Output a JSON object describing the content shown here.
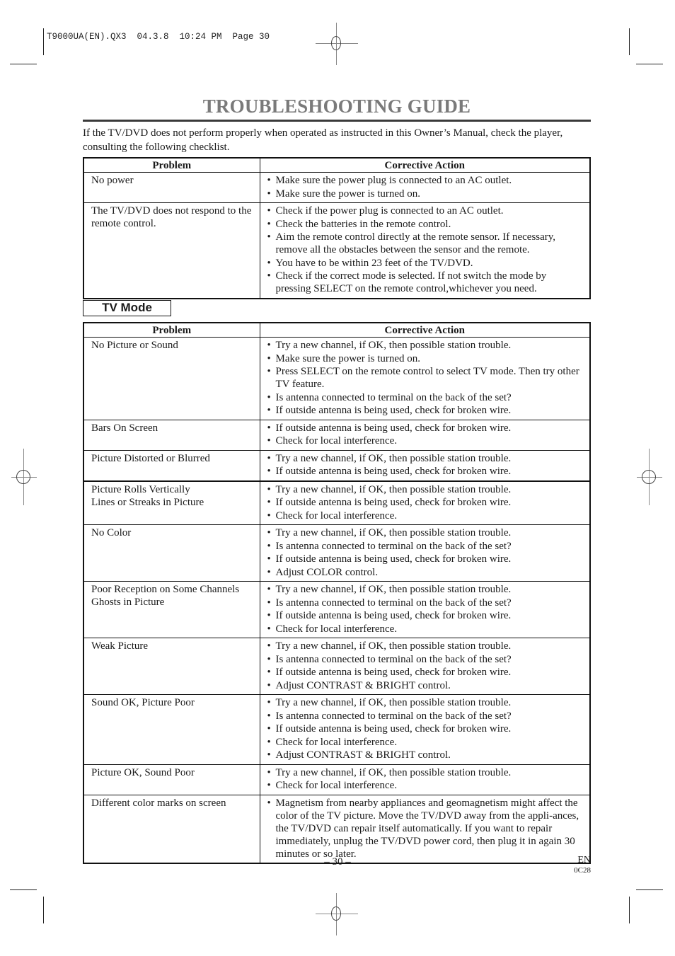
{
  "slug": "T9000UA(EN).QX3  04.3.8  10:24 PM  Page 30",
  "title": "TROUBLESHOOTING GUIDE",
  "intro": "If the TV/DVD does not perform properly when operated as instructed in this Owner’s Manual, check the player, consulting the following checklist.",
  "colors": {
    "title": "#7a7a7a",
    "rule": "#3a3a3a",
    "text": "#1a1a1a"
  },
  "general_table": {
    "headers": {
      "problem": "Problem",
      "action": "Corrective Action"
    },
    "rows": [
      {
        "problem": [
          "No power"
        ],
        "actions": [
          "Make sure the power plug is connected to an AC outlet.",
          "Make sure the power is turned on."
        ]
      },
      {
        "problem": [
          "The TV/DVD does not respond to the remote control."
        ],
        "actions": [
          "Check if the power plug is connected to an AC outlet.",
          "Check the batteries in the remote control.",
          "Aim the remote control directly at the remote sensor. If necessary, remove all the obstacles between the sensor and the remote.",
          "You have to be within 23 feet of the TV/DVD.",
          "Check if the correct mode is selected. If not switch the mode by pressing SELECT on the remote control,whichever you need."
        ]
      }
    ]
  },
  "tv_mode": {
    "label": "TV Mode",
    "headers": {
      "problem": "Problem",
      "action": "Corrective Action"
    },
    "rows": [
      {
        "problem": [
          "No Picture or Sound"
        ],
        "actions": [
          "Try a new channel, if OK, then possible station trouble.",
          "Make sure the power is turned on.",
          "Press SELECT on the remote control to select TV mode. Then try other TV feature.",
          "Is antenna connected to terminal on the back of the set?",
          "If outside antenna is being used, check for broken wire."
        ]
      },
      {
        "problem": [
          "Bars On Screen"
        ],
        "actions": [
          "If outside antenna is being used, check for broken wire.",
          "Check for local interference."
        ]
      },
      {
        "problem": [
          "Picture Distorted or Blurred"
        ],
        "actions": [
          "Try a new channel, if OK, then possible station trouble.",
          "If outside antenna is being used, check for broken wire."
        ]
      },
      {
        "problem": [
          "Picture Rolls Vertically",
          "Lines or Streaks in Picture"
        ],
        "actions": [
          "Try a new channel, if OK, then possible station trouble.",
          "If outside antenna is being used, check for broken wire.",
          "Check for local interference."
        ]
      },
      {
        "problem": [
          "No Color"
        ],
        "actions": [
          "Try a new channel, if OK, then possible station trouble.",
          "Is antenna connected to terminal on the back of the set?",
          "If outside antenna is being used, check for broken wire.",
          "Adjust COLOR control."
        ]
      },
      {
        "problem": [
          "Poor Reception on Some Channels",
          "Ghosts in Picture"
        ],
        "actions": [
          "Try a new channel, if OK, then possible station trouble.",
          "Is antenna connected to terminal on the back of the set?",
          "If outside antenna is being used, check for broken wire.",
          "Check for local interference."
        ]
      },
      {
        "problem": [
          "Weak Picture"
        ],
        "actions": [
          "Try a new channel, if OK, then possible station trouble.",
          "Is antenna connected to terminal on the back of the set?",
          "If outside antenna is being used, check for broken wire.",
          "Adjust CONTRAST & BRIGHT control."
        ]
      },
      {
        "problem": [
          "Sound OK, Picture Poor"
        ],
        "actions": [
          "Try a new channel, if OK, then possible station trouble.",
          "Is antenna connected to terminal on the back of the set?",
          "If outside antenna is being used, check for broken wire.",
          "Check for local interference.",
          "Adjust CONTRAST & BRIGHT control."
        ]
      },
      {
        "problem": [
          "Picture OK, Sound Poor"
        ],
        "actions": [
          "Try a new channel, if OK, then possible station trouble.",
          "Check for local interference."
        ]
      },
      {
        "problem": [
          "Different color marks on screen"
        ],
        "actions": [
          "Magnetism from nearby appliances and geomagnetism might affect the color of the TV picture. Move the TV/DVD away from the appli-ances, the TV/DVD can repair itself automatically. If you want to repair immediately, unplug the TV/DVD power cord, then plug it in again 30 minutes or so later."
        ]
      }
    ]
  },
  "footer": {
    "page_number": "– 30 –",
    "language": "EN",
    "code": "0C28"
  }
}
